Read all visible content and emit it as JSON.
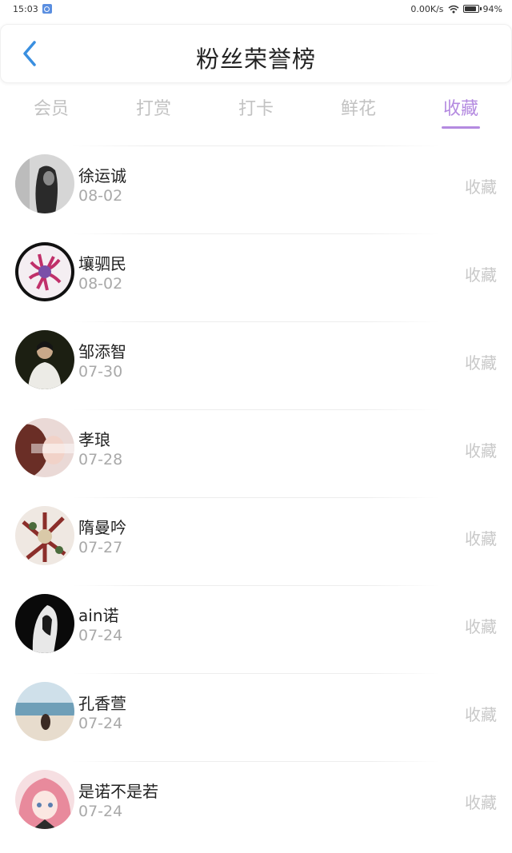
{
  "status_bar": {
    "time": "15:03",
    "network_speed": "0.00K/s",
    "battery": "94%"
  },
  "header": {
    "title": "粉丝荣誉榜",
    "back_icon": "chevron-left-icon",
    "accent": "#3a8fe0"
  },
  "tabs": [
    {
      "label": "会员",
      "active": false
    },
    {
      "label": "打赏",
      "active": false
    },
    {
      "label": "打卡",
      "active": false
    },
    {
      "label": "鲜花",
      "active": false
    },
    {
      "label": "收藏",
      "active": true
    }
  ],
  "colors": {
    "active_tab": "#b48ae0",
    "inactive_tab": "#c2c2c2",
    "date_text": "#a9a9a9",
    "action_text": "#c8c8c8"
  },
  "fans": [
    {
      "name": "徐运诚",
      "date": "08-02",
      "action": "收藏"
    },
    {
      "name": "壤驷民",
      "date": "08-02",
      "action": "收藏"
    },
    {
      "name": "邹添智",
      "date": "07-30",
      "action": "收藏"
    },
    {
      "name": "孝琅",
      "date": "07-28",
      "action": "收藏"
    },
    {
      "name": "隋曼吟",
      "date": "07-27",
      "action": "收藏"
    },
    {
      "name": "ain诺",
      "date": "07-24",
      "action": "收藏"
    },
    {
      "name": "孔香萱",
      "date": "07-24",
      "action": "收藏"
    },
    {
      "name": "是诺不是若",
      "date": "07-24",
      "action": "收藏"
    }
  ]
}
